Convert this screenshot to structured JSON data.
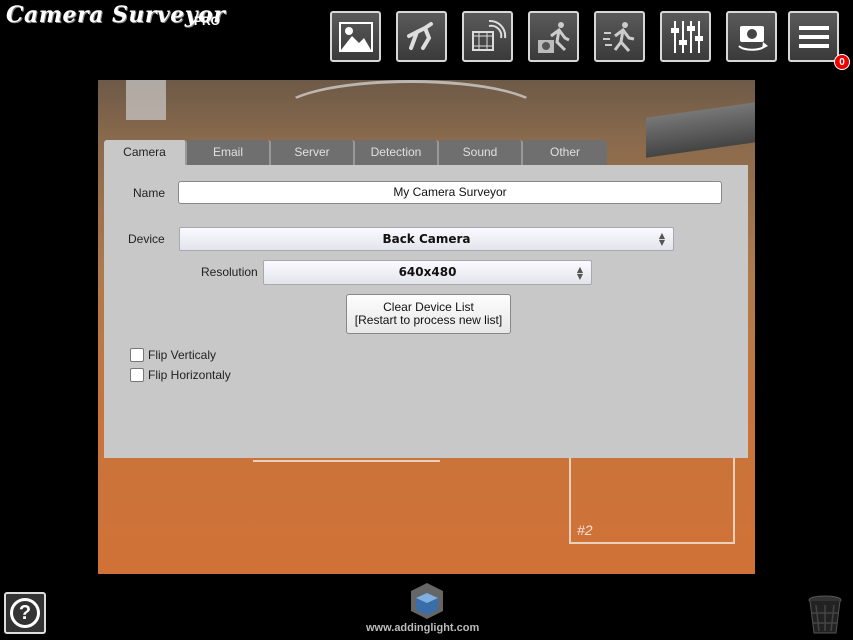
{
  "app": {
    "title": "Camera Surveyor",
    "edition": "PRO"
  },
  "toolbar": {
    "buttons": [
      {
        "icon": "image-icon"
      },
      {
        "icon": "motion-gesture-icon"
      },
      {
        "icon": "video-stream-icon"
      },
      {
        "icon": "camera-motion-icon"
      },
      {
        "icon": "running-person-icon"
      },
      {
        "icon": "sliders-icon"
      },
      {
        "icon": "camera-switch-icon"
      },
      {
        "icon": "menu-icon"
      }
    ],
    "notification_count": "0"
  },
  "camera_view": {
    "zone_label": "#2"
  },
  "tabs": [
    {
      "label": "Camera",
      "active": true
    },
    {
      "label": "Email"
    },
    {
      "label": "Server"
    },
    {
      "label": "Detection"
    },
    {
      "label": "Sound"
    },
    {
      "label": "Other"
    }
  ],
  "camera_settings": {
    "name_label": "Name",
    "name_value": "My Camera Surveyor",
    "device_label": "Device",
    "device_value": "Back Camera",
    "resolution_label": "Resolution",
    "resolution_value": "640x480",
    "clear_button_line1": "Clear Device List",
    "clear_button_line2": "[Restart to process new list]",
    "flip_vertical_label": "Flip Verticaly",
    "flip_horizontal_label": "Flip Horizontaly"
  },
  "footer": {
    "website": "www.addinglight.com"
  }
}
